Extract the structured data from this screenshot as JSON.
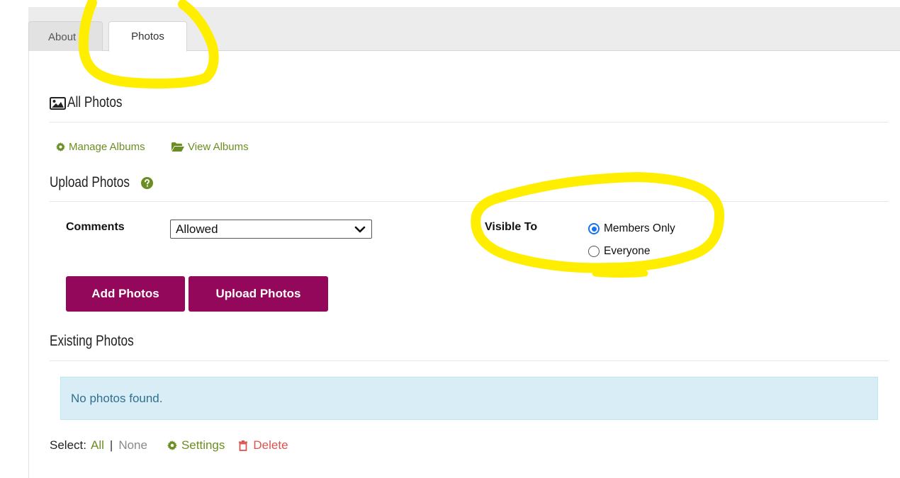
{
  "tabs": [
    {
      "label": "About",
      "active": false
    },
    {
      "label": "Photos",
      "active": true
    }
  ],
  "section": {
    "title": "All Photos",
    "icon": "image-icon"
  },
  "links": {
    "manage_albums": "Manage Albums",
    "view_albums": "View Albums"
  },
  "upload": {
    "heading": "Upload Photos",
    "help_icon": "question-circle-icon",
    "comments_label": "Comments",
    "comments_value": "Allowed",
    "visible_label": "Visible To",
    "visible_options": [
      {
        "label": "Members Only",
        "selected": true
      },
      {
        "label": "Everyone",
        "selected": false
      }
    ],
    "add_button": "Add Photos",
    "upload_button": "Upload Photos"
  },
  "existing": {
    "heading": "Existing Photos",
    "empty_message": "No photos found."
  },
  "select_bar": {
    "label": "Select:",
    "all": "All",
    "separator": "|",
    "none": "None",
    "settings": "Settings",
    "delete": "Delete"
  },
  "colors": {
    "brand_button": "#93085a",
    "link_green": "#6b8e23",
    "delete_red": "#d9534f",
    "info_bg": "#d9edf7",
    "highlight_yellow": "#ffee00"
  }
}
